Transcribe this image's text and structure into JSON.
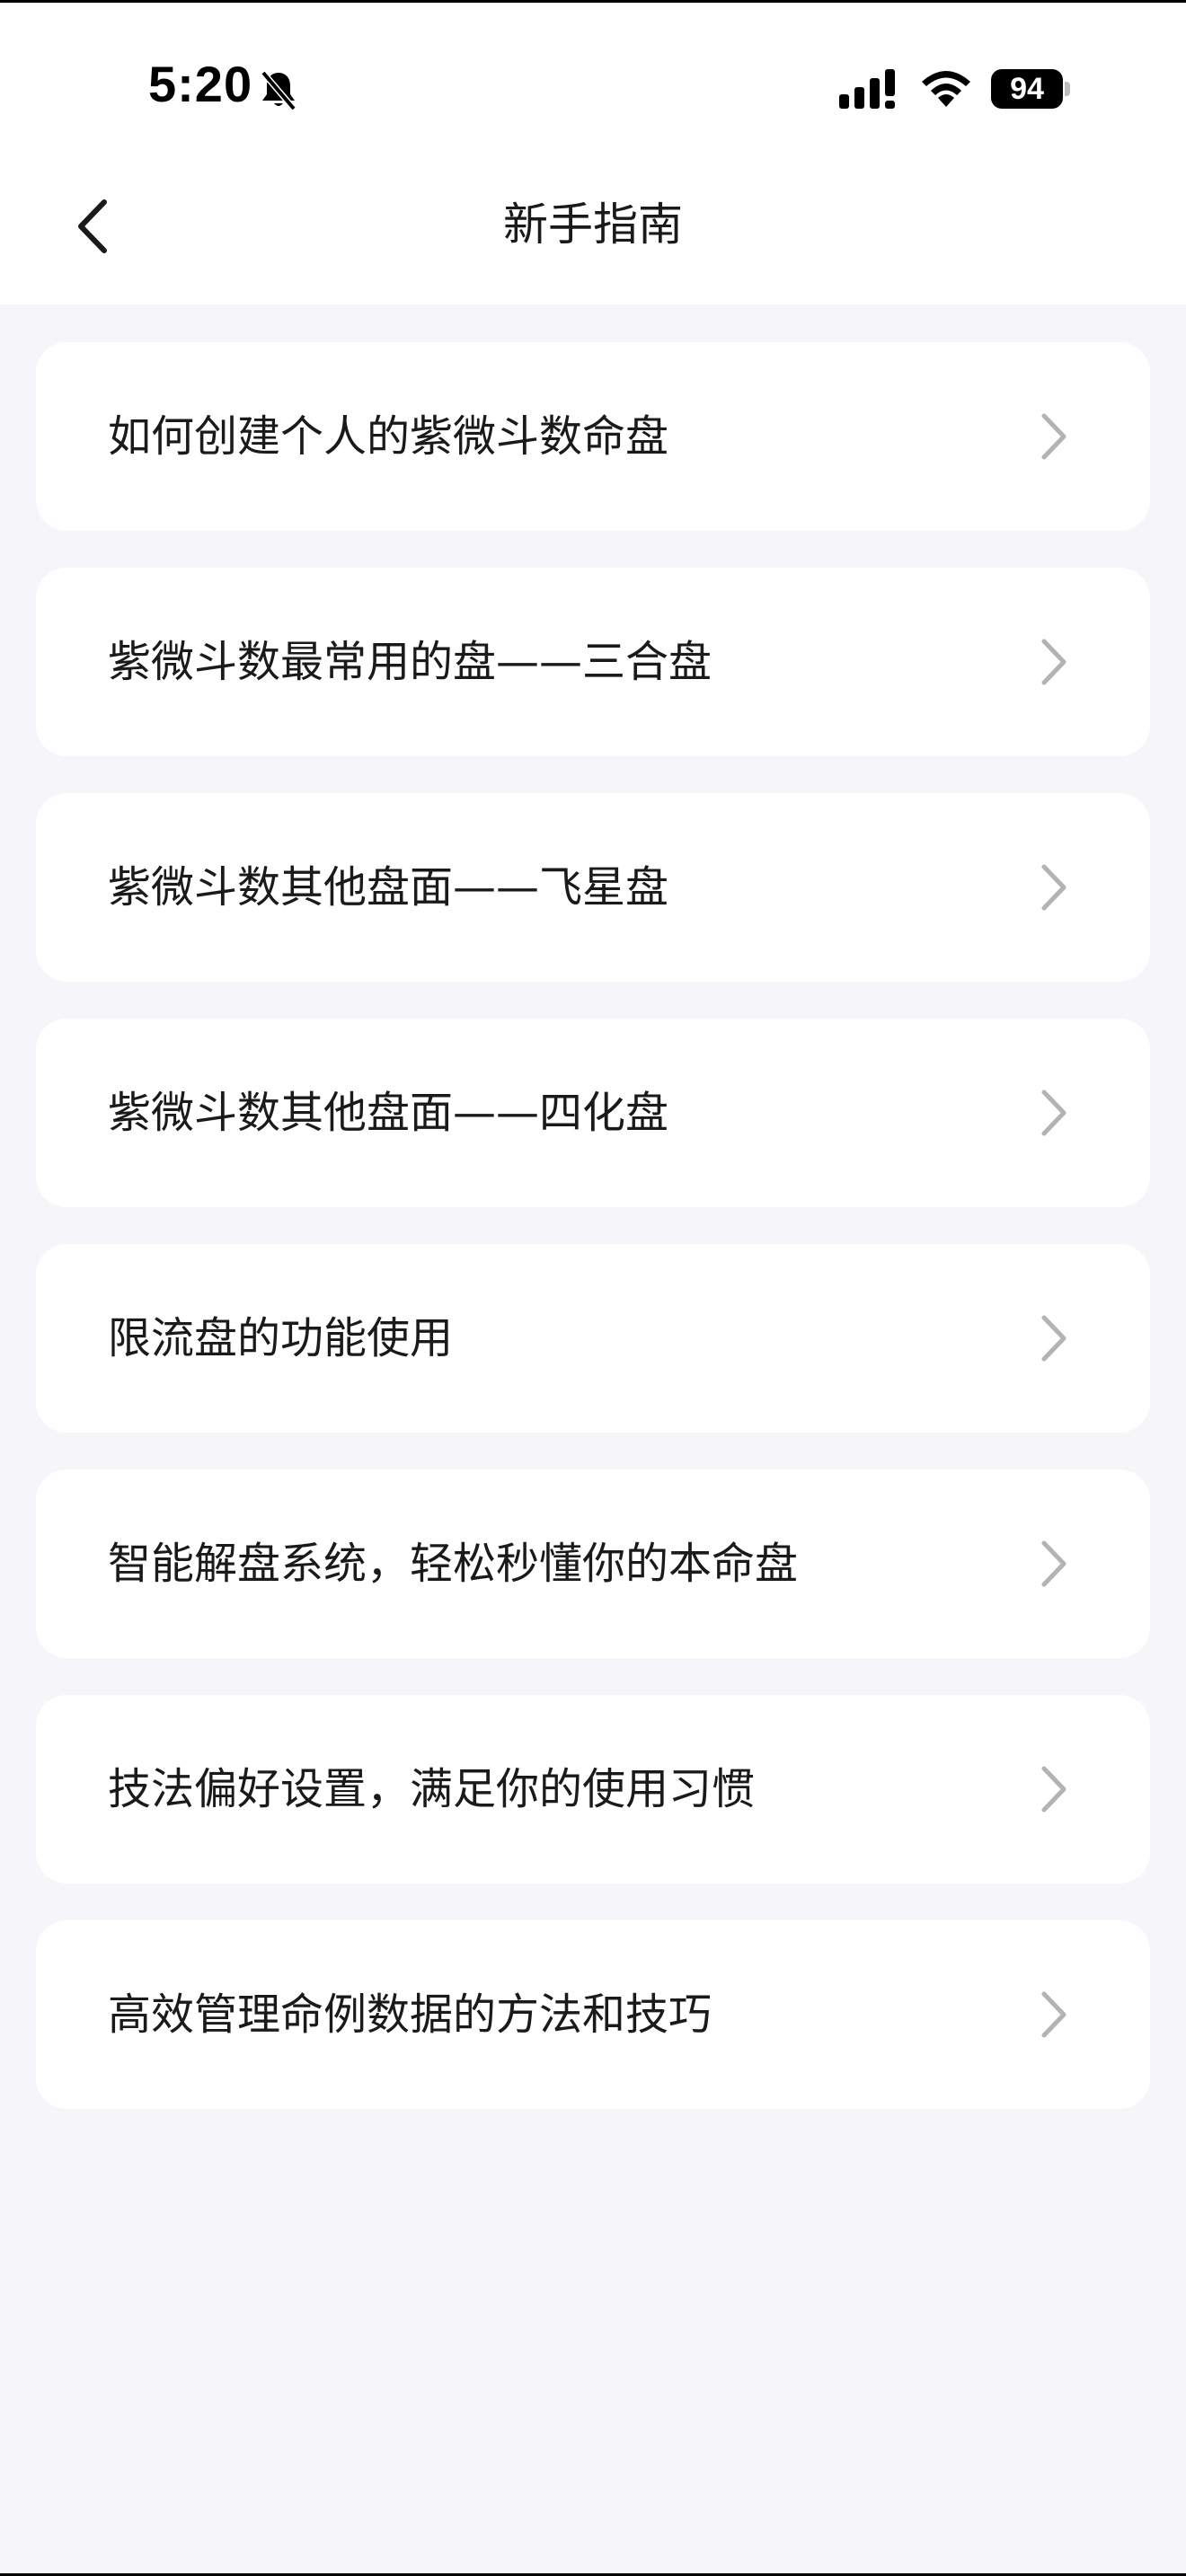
{
  "status_bar": {
    "time": "5:20",
    "battery": "94",
    "icons": [
      "bell-slash-icon",
      "signal-icon",
      "wifi-icon",
      "battery-icon"
    ]
  },
  "nav": {
    "title": "新手指南",
    "back_icon": "chevron-left-icon"
  },
  "guide_items": [
    {
      "label": "如何创建个人的紫微斗数命盘"
    },
    {
      "label": "紫微斗数最常用的盘——三合盘"
    },
    {
      "label": "紫微斗数其他盘面——飞星盘"
    },
    {
      "label": "紫微斗数其他盘面——四化盘"
    },
    {
      "label": "限流盘的功能使用"
    },
    {
      "label": "智能解盘系统，轻松秒懂你的本命盘"
    },
    {
      "label": "技法偏好设置，满足你的使用习惯"
    },
    {
      "label": "高效管理命例数据的方法和技巧"
    }
  ],
  "colors": {
    "background": "#f5f5fa",
    "card": "#ffffff",
    "text": "#1a1a1a",
    "chevron": "#b3b3b3"
  }
}
